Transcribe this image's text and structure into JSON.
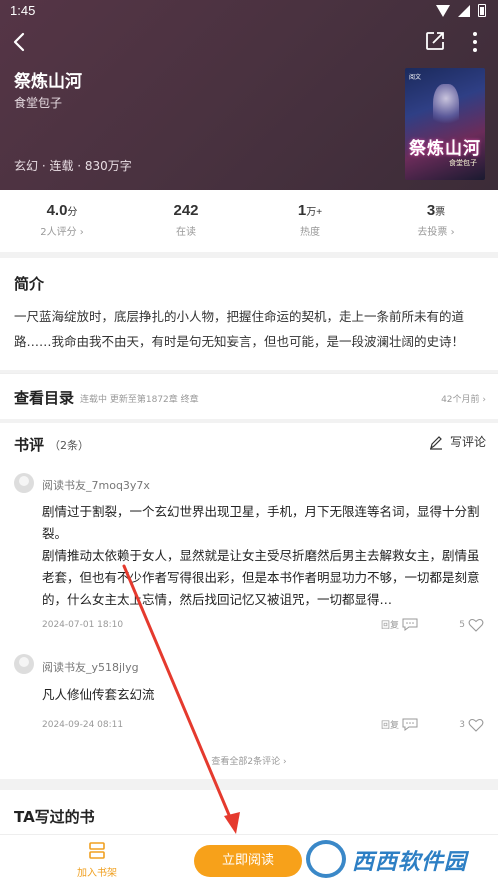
{
  "status_bar": {
    "time": "1:45"
  },
  "header": {
    "title": "祭炼山河",
    "author": "食堂包子",
    "meta": "玄幻 · 连载 · 830万字",
    "cover_title": "祭炼山河",
    "cover_publisher": "阅文",
    "cover_author": "食堂包子"
  },
  "stats": [
    {
      "value": "4.0",
      "unit": "分",
      "label": "2人评分 ›"
    },
    {
      "value": "242",
      "unit": "",
      "label": "在读"
    },
    {
      "value": "1",
      "unit": "万+",
      "label": "热度"
    },
    {
      "value": "3",
      "unit": "票",
      "label": "去投票 ›"
    }
  ],
  "intro": {
    "title": "简介",
    "text": "一尺蓝海绽放时，底层挣扎的小人物，把握住命运的契机，走上一条前所未有的道路……我命由我不由天，有时是句无知妄言，但也可能，是一段波澜壮阔的史诗！"
  },
  "toc": {
    "title": "查看目录",
    "status": "连载中 更新至第1872章 终章",
    "ago": "42个月前 ›"
  },
  "reviews": {
    "title": "书评",
    "count": "（2条）",
    "write_label": "写评论",
    "items": [
      {
        "name": "阅读书友_7moq3y7x",
        "text": "剧情过于割裂，一个玄幻世界出现卫星，手机，月下无限连等名词，显得十分割裂。\n剧情推动太依赖于女人，显然就是让女主受尽折磨然后男主去解救女主，剧情虽老套，但也有不少作者写得很出彩，但是本书作者明显功力不够，一切都是刻意的，什么女主太上忘情，然后找回记忆又被诅咒，一切都显得…",
        "date": "2024-07-01 18:10",
        "reply": "回复",
        "likes": "5"
      },
      {
        "name": "阅读书友_y518jlyg",
        "text": "凡人修仙传套玄幻流",
        "date": "2024-09-24 08:11",
        "reply": "回复",
        "likes": "3"
      }
    ],
    "see_all": "查看全部2条评论 ›"
  },
  "works": {
    "title": "TA写过的书"
  },
  "bottom": {
    "shelf_label": "加入书架",
    "read_label": "立即阅读"
  },
  "watermark": {
    "text": "西西软件园"
  },
  "colors": {
    "accent": "#f7a11a",
    "header_bg": "#4a3240",
    "annotation_arrow": "#e53a2e"
  }
}
